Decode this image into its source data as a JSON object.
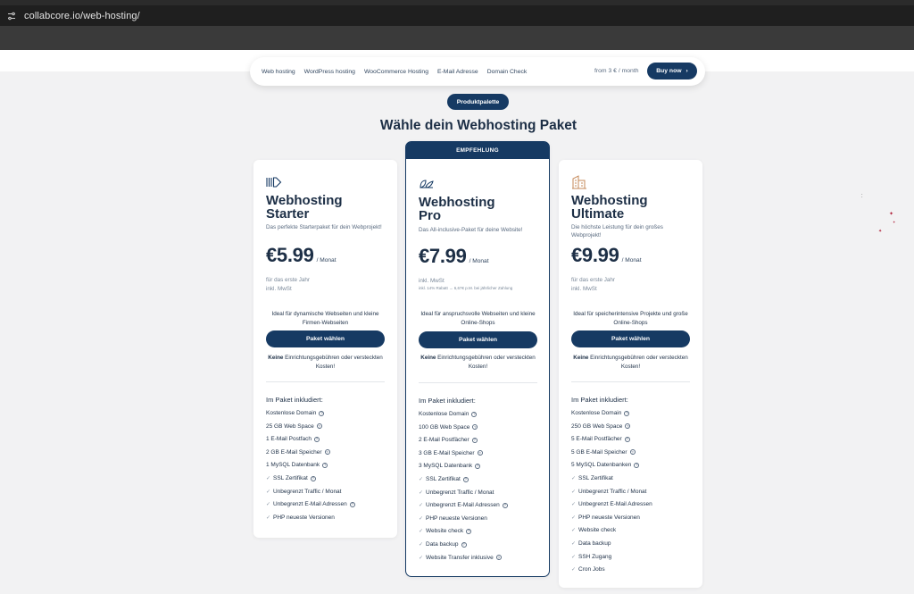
{
  "browser": {
    "url": "collabcore.io/web-hosting/"
  },
  "nav": {
    "links": [
      "Web hosting",
      "WordPress hosting",
      "WooCommerce Hosting",
      "E-Mail Adresse",
      "Domain Check"
    ],
    "from_text": "from 3 € / month",
    "buy_label": "Buy now",
    "buy_chevron": "›"
  },
  "badge": "Produktpalette",
  "section_title": "Wähle dein Webhosting Paket",
  "recommend_label": "EMPFEHLUNG",
  "plans": [
    {
      "name_line1": "Webhosting",
      "name_line2": "Starter",
      "desc": "Das perfekte Starterpaket für dein Webprojekt!",
      "price": "€5.99",
      "per": "/ Monat",
      "note1": "für das erste Jahr",
      "note2": "inkl. MwSt",
      "ideal": "Ideal für dynamische Webseiten und kleine Firmen-Webseiten",
      "button": "Paket wählen",
      "nofee_bold": "Keine",
      "nofee_rest": " Einrichtungsgebühren oder versteckten Kosten!",
      "included_heading": "Im Paket inkludiert:",
      "features": [
        {
          "label": "Kostenlose Domain",
          "check": false,
          "help": true
        },
        {
          "label": "25 GB Web Space",
          "check": false,
          "help": true
        },
        {
          "label": "1 E-Mail Postfach",
          "check": false,
          "help": true
        },
        {
          "label": "2 GB E-Mail Speicher",
          "check": false,
          "help": true
        },
        {
          "label": "1 MySQL Datenbank",
          "check": false,
          "help": true
        },
        {
          "label": "SSL Zertifikat",
          "check": true,
          "help": true
        },
        {
          "label": "Unbegrenzt Traffic / Monat",
          "check": true,
          "help": false
        },
        {
          "label": "Unbegrenzt E-Mail Adressen",
          "check": true,
          "help": true
        },
        {
          "label": "PHP neueste Versionen",
          "check": true,
          "help": false
        }
      ]
    },
    {
      "name_line1": "Webhosting",
      "name_line2": "Pro",
      "desc": "Das All-inclusive-Paket für deine Website!",
      "price": "€7.99",
      "per": "/ Monat",
      "note1": "inkl. MwSt",
      "tiny": "inkl. 14% Rabatt → 6,67€ p.M. bei jährlicher Zahlung",
      "ideal": "Ideal für anspruchsvolle Webseiten und kleine Online-Shops",
      "button": "Paket wählen",
      "nofee_bold": "Keine",
      "nofee_rest": " Einrichtungsgebühren oder versteckten Kosten!",
      "included_heading": "Im Paket inkludiert:",
      "features": [
        {
          "label": "Kostenlose Domain",
          "check": false,
          "help": true
        },
        {
          "label": "100 GB Web Space",
          "check": false,
          "help": true
        },
        {
          "label": "2 E-Mail Postfächer",
          "check": false,
          "help": true
        },
        {
          "label": "3 GB E-Mail Speicher",
          "check": false,
          "help": true
        },
        {
          "label": "3 MySQL Datenbank",
          "check": false,
          "help": true
        },
        {
          "label": "SSL Zertifikat",
          "check": true,
          "help": true
        },
        {
          "label": "Unbegrenzt Traffic / Monat",
          "check": true,
          "help": false
        },
        {
          "label": "Unbegrenzt E-Mail Adressen",
          "check": true,
          "help": true
        },
        {
          "label": "PHP neueste Versionen",
          "check": true,
          "help": false
        },
        {
          "label": "Website check",
          "check": true,
          "help": true
        },
        {
          "label": "Data backup",
          "check": true,
          "help": true
        },
        {
          "label": "Website Transfer inklusive",
          "check": true,
          "help": true
        }
      ]
    },
    {
      "name_line1": "Webhosting",
      "name_line2": "Ultimate",
      "desc": "Die höchste Leistung für dein großes Webprojekt!",
      "price": "€9.99",
      "per": "/ Monat",
      "note1": "für das erste Jahr",
      "note2": "inkl. MwSt",
      "ideal": "Ideal für speicherintensive Projekte und große Online-Shops",
      "button": "Paket wählen",
      "nofee_bold": "Keine",
      "nofee_rest": " Einrichtungsgebühren oder versteckten Kosten!",
      "included_heading": "Im Paket inkludiert:",
      "features": [
        {
          "label": "Kostenlose Domain",
          "check": false,
          "help": true
        },
        {
          "label": "250 GB Web Space",
          "check": false,
          "help": true
        },
        {
          "label": "5 E-Mail Postfächer",
          "check": false,
          "help": true
        },
        {
          "label": "5 GB E-Mail Speicher",
          "check": false,
          "help": true
        },
        {
          "label": "5 MySQL Datenbanken",
          "check": false,
          "help": true
        },
        {
          "label": "SSL Zertifikat",
          "check": true,
          "help": false
        },
        {
          "label": "Unbegrenzt Traffic / Monat",
          "check": true,
          "help": false
        },
        {
          "label": "Unbegrenzt E-Mail Adressen",
          "check": true,
          "help": false
        },
        {
          "label": "PHP neueste Versionen",
          "check": true,
          "help": false
        },
        {
          "label": "Website check",
          "check": true,
          "help": false
        },
        {
          "label": "Data backup",
          "check": true,
          "help": false
        },
        {
          "label": "SSH Zugang",
          "check": true,
          "help": false
        },
        {
          "label": "Cron Jobs",
          "check": true,
          "help": false
        }
      ]
    }
  ],
  "icons": {
    "help": "question-circle-icon",
    "check": "check-icon",
    "site_settings": "site-settings-icon",
    "starter": "arrow-right-icon",
    "pro": "leaf-icon",
    "ultimate": "building-icon"
  },
  "colors": {
    "primary": "#163a63",
    "accent_icon": "#c58a5a",
    "background": "#f2f2f3"
  }
}
